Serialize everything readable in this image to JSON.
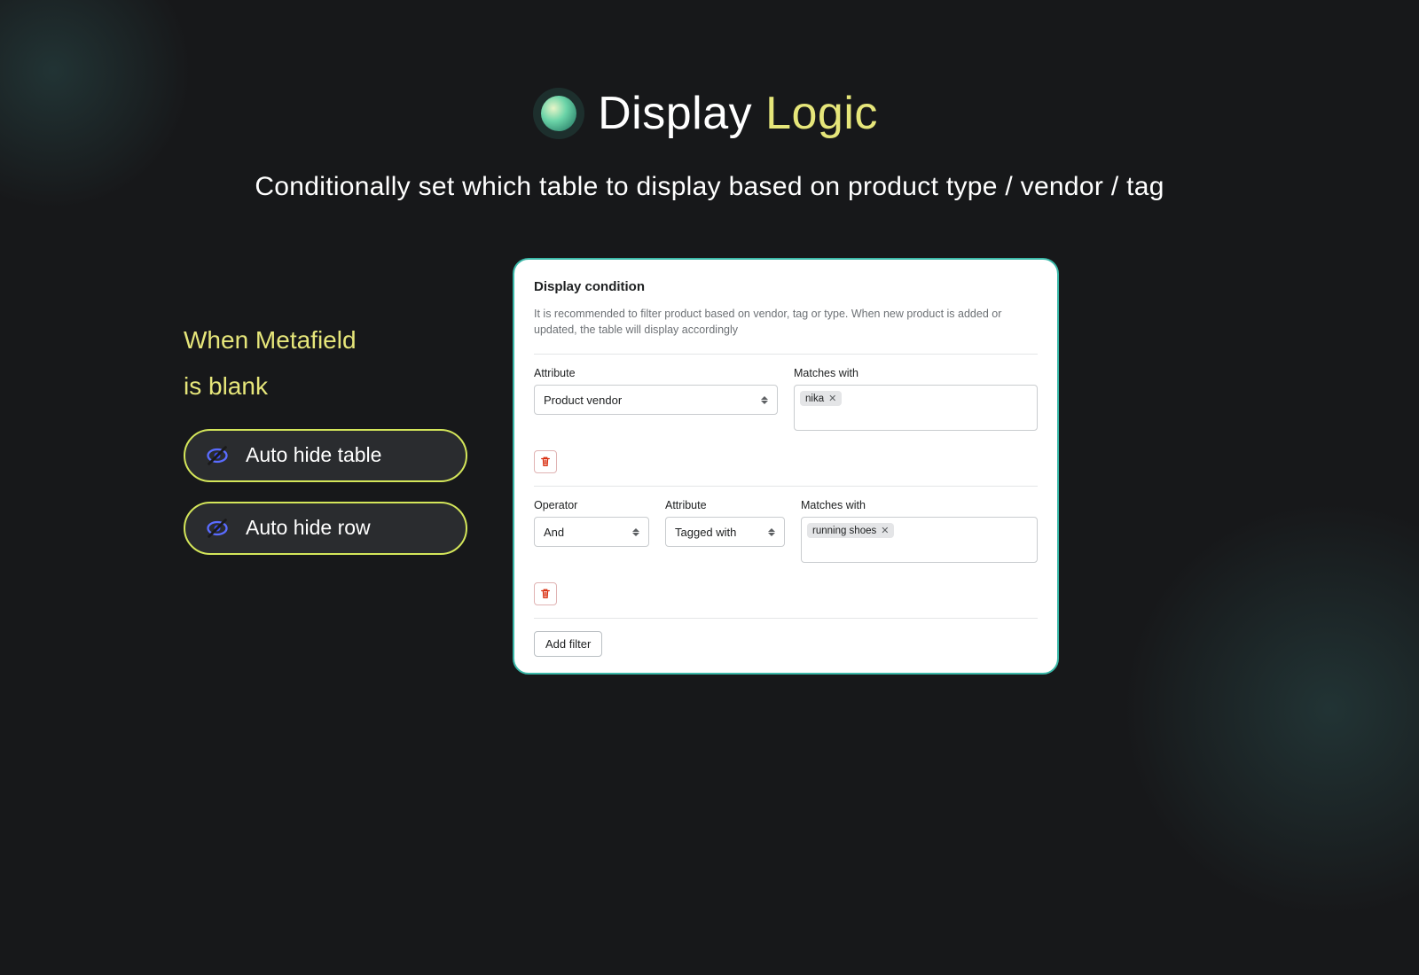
{
  "hero": {
    "title_a": "Display",
    "title_b": "Logic",
    "subtitle": "Conditionally set which table to display based on product type / vendor / tag"
  },
  "left": {
    "heading_l1": "When Metafield",
    "heading_l2": "is blank",
    "pill1": "Auto hide table",
    "pill2": "Auto hide row"
  },
  "panel": {
    "title": "Display condition",
    "desc": "It is recommended to filter product based on vendor, tag or type. When new product is added or updated, the table will display accordingly",
    "labels": {
      "attribute": "Attribute",
      "matches": "Matches with",
      "operator": "Operator"
    },
    "row1": {
      "attribute": "Product vendor",
      "tag": "nika"
    },
    "row2": {
      "operator": "And",
      "attribute": "Tagged with",
      "tag": "running shoes"
    },
    "add_filter": "Add filter"
  }
}
